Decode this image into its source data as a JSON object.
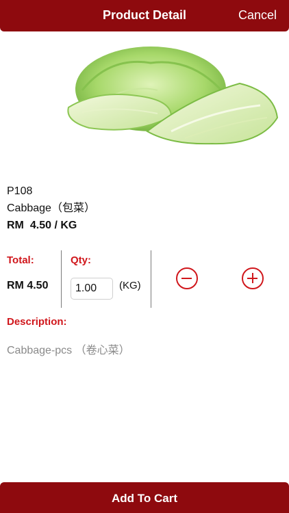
{
  "header": {
    "title": "Product Detail",
    "cancel_label": "Cancel"
  },
  "product": {
    "image_icon": "cabbage-image",
    "code": "P108",
    "name": "Cabbage（包菜）",
    "currency": "RM",
    "price": "4.50 / KG"
  },
  "order": {
    "total_label": "Total:",
    "total_value": "RM 4.50",
    "qty_label": "Qty:",
    "qty_value": "1.00",
    "qty_unit": "(KG)"
  },
  "description": {
    "label": "Description:",
    "text": "Cabbage-pcs （卷心菜）"
  },
  "footer": {
    "add_to_cart_label": "Add To Cart"
  },
  "colors": {
    "brand": "#8e0a0e",
    "accent_red": "#d0161b",
    "muted_text": "#8a8a8a"
  }
}
